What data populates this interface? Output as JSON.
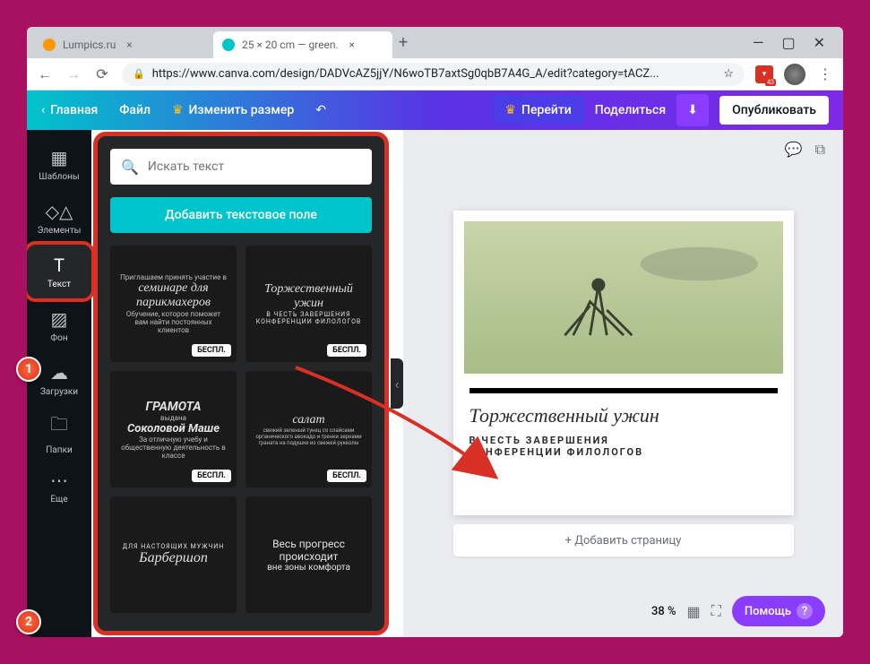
{
  "browser": {
    "tabs": [
      {
        "title": "Lumpics.ru",
        "favicon_color": "#ff9800"
      },
      {
        "title": "25 × 20 cm — green.",
        "favicon_color": "#00c4cc"
      }
    ],
    "url": "https://www.canva.com/design/DADVcAZ5jjY/N6woTB7axtSg0qbB7A4G_A/edit?category=tACZ...",
    "star": "☆"
  },
  "header": {
    "home": "Главная",
    "file": "Файл",
    "resize": "Изменить размер",
    "upgrade": "Перейти",
    "share": "Поделиться",
    "publish": "Опубликовать"
  },
  "sidebar": {
    "items": [
      {
        "label": "Шаблоны"
      },
      {
        "label": "Элементы"
      },
      {
        "label": "Текст"
      },
      {
        "label": "Фон"
      },
      {
        "label": "Загрузки"
      },
      {
        "label": "Папки"
      },
      {
        "label": "Еще"
      }
    ]
  },
  "panel": {
    "search_placeholder": "Искать текст",
    "add_text_btn": "Добавить текстовое поле",
    "templates": [
      {
        "small": "Приглашаем принять участие в",
        "main": "семинаре для парикмахеров",
        "sub": "Обучение, которое поможет вам найти постоянных клиентов",
        "badge": "БЕСПЛ."
      },
      {
        "small": "",
        "main": "Торжественный ужин",
        "sub": "В ЧЕСТЬ ЗАВЕРШЕНИЯ КОНФЕРЕНЦИИ ФИЛОЛОГОВ",
        "badge": "БЕСПЛ."
      },
      {
        "small": "выдана",
        "main": "ГРАМОТА",
        "sub": "Соколовой Маше",
        "extra": "За отличную учебу и общественную деятельность в классе",
        "badge": "БЕСПЛ."
      },
      {
        "small": "",
        "main": "салат",
        "sub": "свежий зеленый тунец со слайсами органического авокадо и гренки зернами граната на подушке из свежей рукколы",
        "badge": "БЕСПЛ."
      },
      {
        "small": "ДЛЯ НАСТОЯЩИХ МУЖЧИН",
        "main": "Барбершоп",
        "sub": "",
        "badge": ""
      },
      {
        "small": "",
        "main": "Весь прогресс происходит",
        "sub": "вне зоны комфорта",
        "badge": ""
      }
    ]
  },
  "canvas": {
    "design_title": "Торжественный ужин",
    "design_sub1": "В ЧЕСТЬ ЗАВЕРШЕНИЯ",
    "design_sub2": "КОНФЕРЕНЦИИ ФИЛОЛОГОВ",
    "add_page": "+ Добавить страницу"
  },
  "footer": {
    "zoom": "38 %",
    "help": "Помощь",
    "help_q": "?"
  },
  "annotations": {
    "badge1": "1",
    "badge2": "2"
  }
}
